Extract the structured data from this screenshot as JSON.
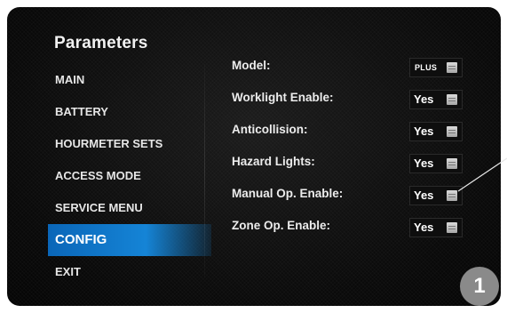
{
  "screen": {
    "title": "Parameters"
  },
  "menu": {
    "items": [
      {
        "label": "MAIN"
      },
      {
        "label": "BATTERY"
      },
      {
        "label": "HOURMETER SETS"
      },
      {
        "label": "ACCESS MODE"
      },
      {
        "label": "SERVICE MENU"
      },
      {
        "label": "CONFIG",
        "active": true
      },
      {
        "label": "EXIT"
      }
    ]
  },
  "params": {
    "rows": [
      {
        "label": "Model:",
        "value": "PLUS"
      },
      {
        "label": "Worklight Enable:",
        "value": "Yes"
      },
      {
        "label": "Anticollision:",
        "value": "Yes"
      },
      {
        "label": "Hazard Lights:",
        "value": "Yes"
      },
      {
        "label": "Manual Op. Enable:",
        "value": "Yes"
      },
      {
        "label": "Zone Op. Enable:",
        "value": "Yes"
      }
    ]
  },
  "callout": {
    "number": "1"
  },
  "colors": {
    "accent": "#1584d6",
    "background": "#0a0a0a",
    "badge": "#8a8a8a"
  },
  "icons": {
    "value_control": "list-icon"
  }
}
